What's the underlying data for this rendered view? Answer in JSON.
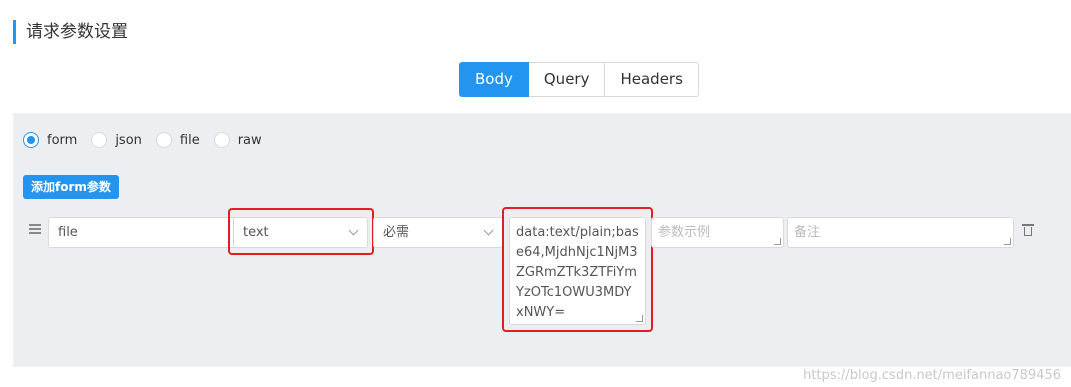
{
  "section": {
    "title": "请求参数设置"
  },
  "tabs": [
    {
      "label": "Body",
      "active": true
    },
    {
      "label": "Query",
      "active": false
    },
    {
      "label": "Headers",
      "active": false
    }
  ],
  "body_type": {
    "options": [
      {
        "label": "form",
        "checked": true
      },
      {
        "label": "json",
        "checked": false
      },
      {
        "label": "file",
        "checked": false
      },
      {
        "label": "raw",
        "checked": false
      }
    ]
  },
  "add_button": {
    "label": "添加form参数"
  },
  "param_row": {
    "name": "file",
    "type_value": "text",
    "required_value": "必需",
    "value_text": "data:text/plain;base64,MjdhNjc1NjM3ZGRmZTk3ZTFiYmYzOTc1OWU3MDYxNWY=",
    "example_placeholder": "参数示例",
    "note_placeholder": "备注"
  },
  "colors": {
    "accent": "#2395f1",
    "highlight": "#e02020",
    "panel_bg": "#eceef1"
  },
  "icons": {
    "drag": "list-drag-icon",
    "delete": "trash-icon",
    "dropdown": "chevron-down-icon"
  },
  "watermark": "https://blog.csdn.net/meifannao789456"
}
